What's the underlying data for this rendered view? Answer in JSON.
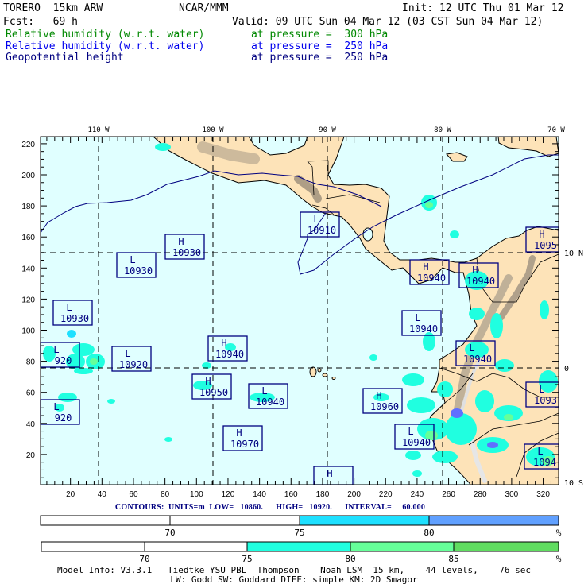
{
  "header": {
    "model": "TORERO  15km ARW",
    "org": "NCAR/MMM",
    "init": "Init: 12 UTC Thu 01 Mar 12",
    "fcst": "Fcst:   69 h",
    "valid": "Valid: 09 UTC Sun 04 Mar 12 (03 CST Sun 04 Mar 12)",
    "fields": [
      {
        "name": "Relative humidity (w.r.t. water)",
        "level": "at pressure =  300 hPa",
        "color": "#008800"
      },
      {
        "name": "Relative humidity (w.r.t. water)",
        "level": "at pressure =  250 hPa",
        "color": "#0000ee"
      },
      {
        "name": "Geopotential height",
        "level": "at pressure =  250 hPa",
        "color": "#000080"
      }
    ]
  },
  "map": {
    "lon_labels": [
      "110 W",
      "100 W",
      "90 W",
      "80 W",
      "70 W"
    ],
    "lat_labels": [
      "10 N",
      "0",
      "10 S"
    ],
    "y_ticks": [
      20,
      40,
      60,
      80,
      100,
      120,
      140,
      160,
      180,
      200,
      220
    ],
    "x_ticks": [
      20,
      40,
      60,
      80,
      100,
      120,
      140,
      160,
      180,
      200,
      220,
      240,
      260,
      280,
      300,
      320
    ],
    "centers": [
      {
        "type": "L",
        "value": "10910"
      },
      {
        "type": "H",
        "value": "10930"
      },
      {
        "type": "L",
        "value": "10930"
      },
      {
        "type": "L",
        "value": "10930"
      },
      {
        "type": "L",
        "value": "920"
      },
      {
        "type": "L",
        "value": "10920"
      },
      {
        "type": "H",
        "value": "10940"
      },
      {
        "type": "H",
        "value": "10950"
      },
      {
        "type": "L",
        "value": "10940"
      },
      {
        "type": "L",
        "value": "920"
      },
      {
        "type": "H",
        "value": "10970"
      },
      {
        "type": "H",
        "value": "10940"
      },
      {
        "type": "H",
        "value": "10940"
      },
      {
        "type": "H",
        "value": "1095"
      },
      {
        "type": "L",
        "value": "10940"
      },
      {
        "type": "L",
        "value": "10940"
      },
      {
        "type": "H",
        "value": "10960"
      },
      {
        "type": "L",
        "value": "10940"
      },
      {
        "type": "L",
        "value": "1093"
      },
      {
        "type": "L",
        "value": "1094"
      },
      {
        "type": "H",
        "value": ""
      }
    ],
    "colors": {
      "ocean": "#e0ffff",
      "land": "#fde3b8",
      "terrain": "#a89c88",
      "contour": "#000080"
    }
  },
  "contours": "CONTOURS:  UNITS=m  LOW=   10860.      HIGH=   10920.      INTERVAL=     60.000",
  "colorbar_250": {
    "labels": [
      "70",
      "75",
      "80",
      "%"
    ],
    "colors": [
      "#ffffff",
      "#ffffff",
      "#1ee0ff",
      "#60a0ff"
    ]
  },
  "colorbar_300": {
    "labels": [
      "70",
      "75",
      "80",
      "85",
      "%"
    ],
    "colors": [
      "#ffffff",
      "#ffffff",
      "#20ffe0",
      "#66ff99",
      "#60dd60"
    ]
  },
  "model_info": [
    "Model Info: V3.3.1   Tiedtke YSU PBL  Thompson    Noah LSM  15 km,    44 levels,    76 sec",
    "LW: Godd SW: Goddard DIFF: simple KM: 2D Smagor"
  ]
}
